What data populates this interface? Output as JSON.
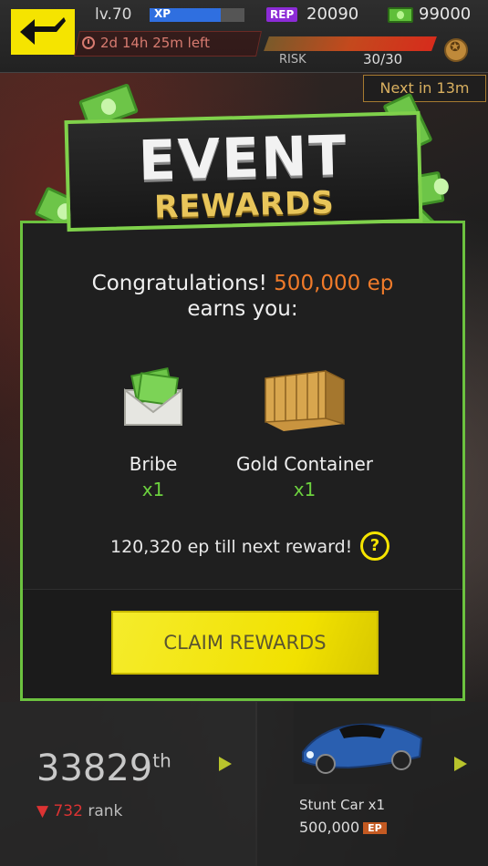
{
  "top_bar": {
    "level": "lv.70",
    "xp_label": "XP",
    "xp_progress": 0.75,
    "rep_label": "REP",
    "rep_value": "20090",
    "cash_value": "99000",
    "timer": "2d 14h 25m left",
    "risk_label": "RISK",
    "risk_value": "30/30",
    "next_in": "Next in 13m"
  },
  "header": {
    "line1": "EVENT",
    "line2": "REWARDS"
  },
  "modal": {
    "congrats_prefix": "Congratulations! ",
    "congrats_highlight": "500,000 ep",
    "congrats_suffix": "earns you:",
    "rewards": [
      {
        "name": "Bribe",
        "qty": "x1",
        "icon": "envelope-cash-icon"
      },
      {
        "name": "Gold Container",
        "qty": "x1",
        "icon": "shipping-container-icon"
      }
    ],
    "till_next": "120,320 ep till next reward!",
    "help_label": "?",
    "claim_label": "CLAIM REWARDS"
  },
  "background": {
    "rank_number": "33829",
    "rank_suffix": "th",
    "rank_delta": "732",
    "rank_word": "rank",
    "car_label": "Stunt Car x1",
    "car_ep": "500,000",
    "ep_tag": "EP"
  },
  "colors": {
    "accent_green": "#6cc23f",
    "highlight_orange": "#f07b2a",
    "button_yellow": "#f5e400"
  }
}
